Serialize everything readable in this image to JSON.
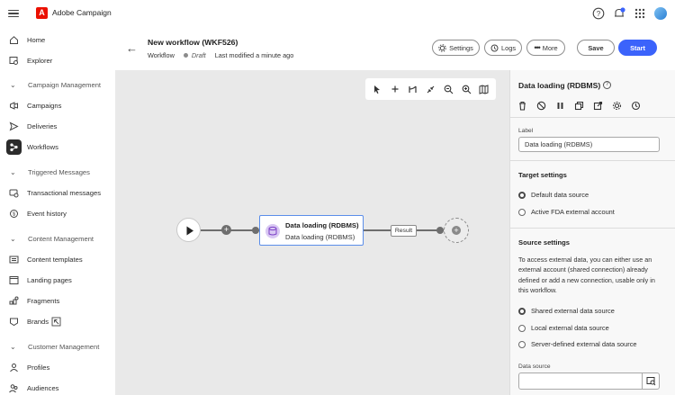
{
  "app": {
    "title": "Adobe Campaign",
    "logo_letter": "A"
  },
  "sidebar": {
    "items": [
      {
        "label": "Home",
        "icon": "home-icon",
        "type": "item"
      },
      {
        "label": "Explorer",
        "icon": "explorer-icon",
        "type": "item"
      },
      {
        "label": "Campaign Management",
        "icon": "chevron-down-icon",
        "type": "section"
      },
      {
        "label": "Campaigns",
        "icon": "campaigns-icon",
        "type": "item"
      },
      {
        "label": "Deliveries",
        "icon": "send-icon",
        "type": "item"
      },
      {
        "label": "Workflows",
        "icon": "workflow-icon",
        "type": "item",
        "active": true
      },
      {
        "label": "Triggered Messages",
        "icon": "chevron-down-icon",
        "type": "section"
      },
      {
        "label": "Transactional messages",
        "icon": "transactional-icon",
        "type": "item"
      },
      {
        "label": "Event history",
        "icon": "event-history-icon",
        "type": "item"
      },
      {
        "label": "Content Management",
        "icon": "chevron-down-icon",
        "type": "section"
      },
      {
        "label": "Content templates",
        "icon": "template-icon",
        "type": "item"
      },
      {
        "label": "Landing pages",
        "icon": "landing-page-icon",
        "type": "item"
      },
      {
        "label": "Fragments",
        "icon": "fragments-icon",
        "type": "item"
      },
      {
        "label": "Brands",
        "icon": "brands-icon",
        "type": "item"
      },
      {
        "label": "Customer Management",
        "icon": "chevron-down-icon",
        "type": "section"
      },
      {
        "label": "Profiles",
        "icon": "profile-icon",
        "type": "item"
      },
      {
        "label": "Audiences",
        "icon": "audiences-icon",
        "type": "item"
      }
    ]
  },
  "workflow": {
    "title": "New workflow (WKF526)",
    "type": "Workflow",
    "status": "Draft",
    "modified": "Last modified a minute ago",
    "buttons": {
      "settings": "Settings",
      "logs": "Logs",
      "more": "More",
      "save": "Save",
      "start": "Start"
    }
  },
  "canvas": {
    "activity": {
      "title": "Data loading (RDBMS)",
      "subtitle": "Data loading (RDBMS)"
    },
    "result_label": "Result"
  },
  "panel": {
    "title": "Data loading (RDBMS)",
    "label_caption": "Label",
    "label_value": "Data loading (RDBMS)",
    "target_settings": "Target settings",
    "target_options": [
      "Default data source",
      "Active FDA external account"
    ],
    "target_selected": 0,
    "source_settings": "Source settings",
    "source_description": "To access external data, you can either use an external account (shared connection) already defined or add a new connection, usable only in this workflow.",
    "source_options": [
      "Shared external data source",
      "Local external data source",
      "Server-defined external data source"
    ],
    "source_selected": 0,
    "data_source_caption": "Data source",
    "data_source_value": ""
  },
  "colors": {
    "accent": "#3b63fb",
    "brand": "#eb1000",
    "canvas": "#e9e9e9",
    "node_border": "#5b8eea"
  }
}
